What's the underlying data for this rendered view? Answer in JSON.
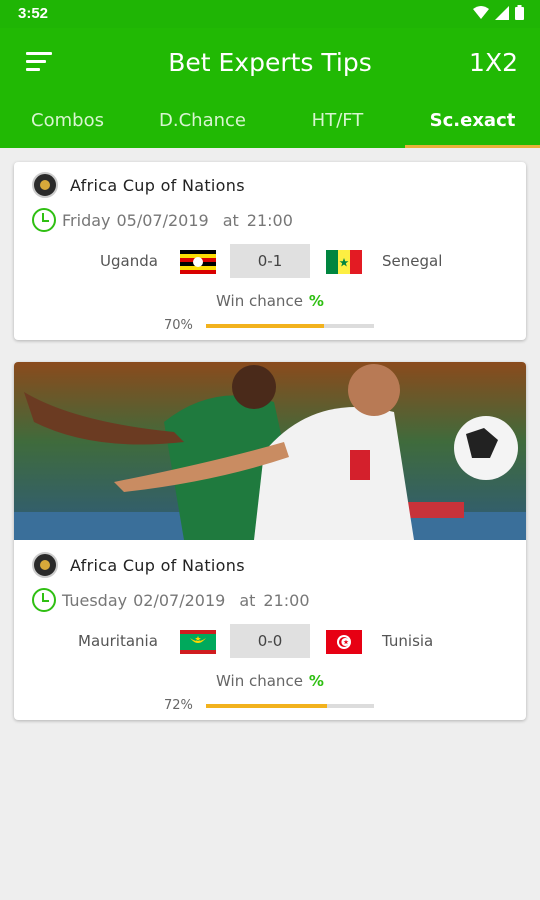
{
  "status": {
    "time": "3:52"
  },
  "appbar": {
    "title": "Bet Experts Tips",
    "action": "1X2"
  },
  "tabs": [
    {
      "label": "Combos"
    },
    {
      "label": "D.Chance"
    },
    {
      "label": "HT/FT"
    },
    {
      "label": "Sc.exact"
    }
  ],
  "colors": {
    "primary": "#21b904",
    "accent": "#f2b21d",
    "clock": "#2fbf12"
  },
  "matches": [
    {
      "league": "Africa Cup of Nations",
      "day": "Friday",
      "date": "05/07/2019",
      "at": "at",
      "time": "21:00",
      "home": "Uganda",
      "away": "Senegal",
      "score": "0-1",
      "win_label": "Win chance",
      "pct_symbol": "%",
      "probability": "70%",
      "probability_value": 0.7
    },
    {
      "league": "Africa Cup of Nations",
      "day": "Tuesday",
      "date": "02/07/2019",
      "at": "at",
      "time": "21:00",
      "home": "Mauritania",
      "away": "Tunisia",
      "score": "0-0",
      "win_label": "Win chance",
      "pct_symbol": "%",
      "probability": "72%",
      "probability_value": 0.72
    }
  ]
}
